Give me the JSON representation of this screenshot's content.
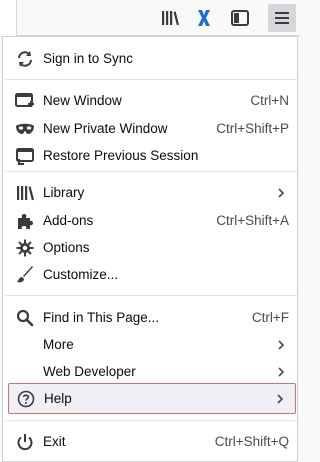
{
  "toolbar": {
    "icons": [
      "library-icon",
      "x-extension-icon",
      "sidebar-icon",
      "menu-icon"
    ]
  },
  "menu": {
    "sync": {
      "label": "Sign in to Sync"
    },
    "new_window": {
      "label": "New Window",
      "shortcut": "Ctrl+N"
    },
    "new_private": {
      "label": "New Private Window",
      "shortcut": "Ctrl+Shift+P"
    },
    "restore": {
      "label": "Restore Previous Session"
    },
    "library": {
      "label": "Library"
    },
    "addons": {
      "label": "Add-ons",
      "shortcut": "Ctrl+Shift+A"
    },
    "options": {
      "label": "Options"
    },
    "customize": {
      "label": "Customize..."
    },
    "find": {
      "label": "Find in This Page...",
      "shortcut": "Ctrl+F"
    },
    "more": {
      "label": "More"
    },
    "web_developer": {
      "label": "Web Developer"
    },
    "help": {
      "label": "Help"
    },
    "exit": {
      "label": "Exit",
      "shortcut": "Ctrl+Shift+Q"
    }
  },
  "colors": {
    "highlight_border": "#e06d6d",
    "accent_blue": "#0a84ff",
    "text": "#0c0c0d"
  }
}
